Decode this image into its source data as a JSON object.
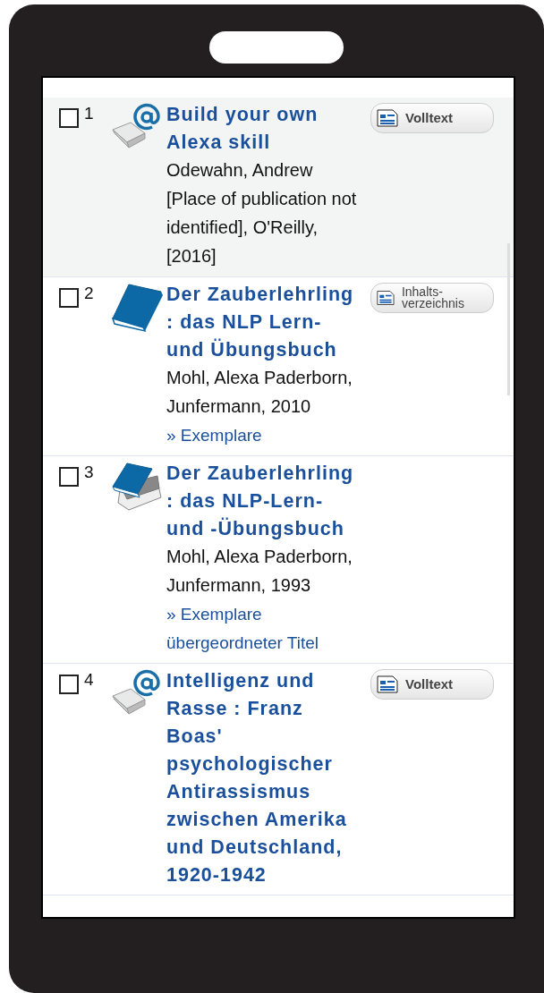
{
  "results": [
    {
      "number": "1",
      "checked": false,
      "selected": true,
      "kind": "ebook",
      "title": "Build your own Alexa skill",
      "details": "Odewahn, Andrew [Place of publication not identified], O'Reilly, [2016]",
      "button": {
        "kind": "fulltext",
        "label": "Volltext"
      }
    },
    {
      "number": "2",
      "checked": false,
      "selected": false,
      "kind": "book",
      "title": "Der Zauberlehrling : das NLP Lern- und Übungsbuch",
      "details": "Mohl, Alexa Paderborn, Junfermann, 2010",
      "links": [
        "» Exemplare"
      ],
      "button": {
        "kind": "toc",
        "label": "Inhalts-verzeichnis"
      }
    },
    {
      "number": "3",
      "checked": false,
      "selected": false,
      "kind": "books",
      "title": "Der Zauberlehrling : das NLP-Lern- und -Übungsbuch",
      "details": "Mohl, Alexa Paderborn, Junfermann, 1993",
      "links": [
        "» Exemplare",
        "übergeordneter Titel"
      ]
    },
    {
      "number": "4",
      "checked": false,
      "selected": false,
      "kind": "ebook",
      "title": "Intelligenz und Rasse : Franz Boas' psychologischer Antirassismus zwischen Amerika und Deutschland, 1920-1942",
      "button": {
        "kind": "fulltext",
        "label": "Volltext"
      }
    }
  ]
}
